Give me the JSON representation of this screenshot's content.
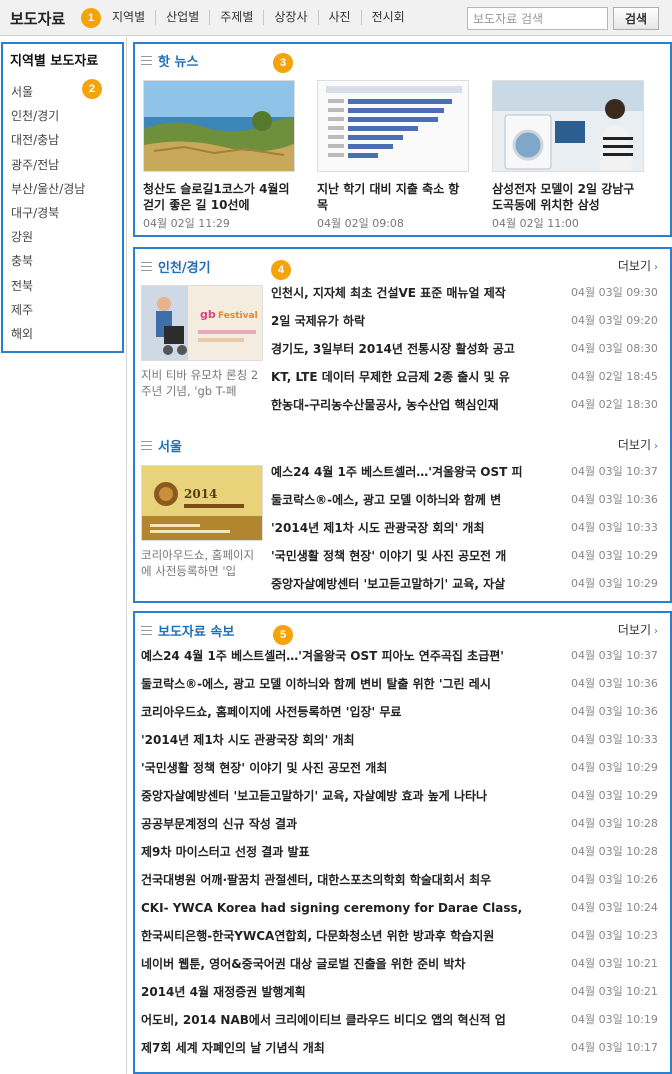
{
  "header": {
    "brand": "보도자료",
    "nav": [
      "지역별",
      "산업별",
      "주제별",
      "상장사",
      "사진",
      "전시회"
    ],
    "search_placeholder": "보도자료 검색",
    "search_button": "검색"
  },
  "markers": [
    "1",
    "2",
    "3",
    "4",
    "5"
  ],
  "sidebar": {
    "title": "지역별 보도자료",
    "items": [
      "서울",
      "인천/경기",
      "대전/충남",
      "광주/전남",
      "부산/울산/경남",
      "대구/경북",
      "강원",
      "충북",
      "전북",
      "제주",
      "해외"
    ]
  },
  "hot": {
    "title": "핫 뉴스",
    "cards": [
      {
        "title": "청산도 슬로길1코스가 4월의 걷기 좋은 길 10선에",
        "date": "04월 02일 11:29",
        "image": "coastal-landscape-photo"
      },
      {
        "title": "지난 학기 대비 지출 축소 항목",
        "date": "04월 02일 09:08",
        "image": "bar-chart-infographic"
      },
      {
        "title": "삼성전자 모델이 2일 강남구 도곡동에 위치한 삼성",
        "date": "04월 02일 11:00",
        "image": "model-with-washer-photo"
      }
    ]
  },
  "incheon": {
    "title": "인천/경기",
    "more": "더보기",
    "thumb_caption": "지비 티바 유모차 론칭 2주년 기념, 'gb T-페",
    "thumb_image": "stroller-festival-banner",
    "rows": [
      {
        "title": "인천시, 지자체 최초 건설VE 표준 매뉴얼 제작",
        "date": "04월 03일 09:30"
      },
      {
        "title": "2일 국제유가 하락",
        "date": "04월 03일 09:20"
      },
      {
        "title": "경기도, 3일부터 2014년 전통시장 활성화 공고",
        "date": "04월 03일 08:30"
      },
      {
        "title": "KT, LTE 데이터 무제한 요금제 2종 출시 및 유",
        "date": "04월 02일 18:45"
      },
      {
        "title": "한농대-구리농수산물공사, 농수산업 핵심인재",
        "date": "04월 02일 18:30"
      }
    ]
  },
  "seoul": {
    "title": "서울",
    "more": "더보기",
    "thumb_caption": "코리아우드쇼, 홈페이지에 사전등록하면 '입",
    "thumb_image": "korea-wood-show-poster",
    "rows": [
      {
        "title": "예스24 4월 1주 베스트셀러…'겨울왕국 OST 피",
        "date": "04월 03일 10:37"
      },
      {
        "title": "둘코락스®-에스, 광고 모델 이하늬와 함께 변",
        "date": "04월 03일 10:36"
      },
      {
        "title": "'2014년 제1차 시도 관광국장 회의' 개최",
        "date": "04월 03일 10:33"
      },
      {
        "title": "'국민생활 정책 현장' 이야기 및 사진 공모전 개",
        "date": "04월 03일 10:29"
      },
      {
        "title": "중앙자살예방센터 '보고듣고말하기' 교육, 자살",
        "date": "04월 03일 10:29"
      }
    ]
  },
  "breaking": {
    "title": "보도자료 속보",
    "more": "더보기",
    "rows": [
      {
        "title": "예스24 4월 1주 베스트셀러…'겨울왕국 OST 피아노 연주곡집 초급편'",
        "date": "04월 03일 10:37"
      },
      {
        "title": "둘코락스®-에스, 광고 모델 이하늬와 함께 변비 탈출 위한 '그린 레시",
        "date": "04월 03일 10:36"
      },
      {
        "title": "코리아우드쇼, 홈페이지에 사전등록하면 '입장' 무료",
        "date": "04월 03일 10:36"
      },
      {
        "title": "'2014년 제1차 시도 관광국장 회의' 개최",
        "date": "04월 03일 10:33"
      },
      {
        "title": "'국민생활 정책 현장' 이야기 및 사진 공모전 개최",
        "date": "04월 03일 10:29"
      },
      {
        "title": "중앙자살예방센터 '보고듣고말하기' 교육, 자살예방 효과 높게 나타나",
        "date": "04월 03일 10:29"
      },
      {
        "title": "공공부문계정의 신규 작성 결과",
        "date": "04월 03일 10:28"
      },
      {
        "title": "제9차 마이스터고 선정 결과 발표",
        "date": "04월 03일 10:28"
      },
      {
        "title": "건국대병원 어깨·팔꿈치 관절센터, 대한스포츠의학회 학술대회서 최우",
        "date": "04월 03일 10:26"
      },
      {
        "title": "CKI- YWCA Korea had signing ceremony for Darae Class,",
        "date": "04월 03일 10:24"
      },
      {
        "title": "한국씨티은행-한국YWCA연합회, 다문화청소년 위한 방과후 학습지원",
        "date": "04월 03일 10:23"
      },
      {
        "title": "네이버 웹툰, 영어&중국어권 대상 글로벌 진출을 위한 준비 박차",
        "date": "04월 03일 10:21"
      },
      {
        "title": "2014년 4월 재정증권 발행계획",
        "date": "04월 03일 10:21"
      },
      {
        "title": "어도비, 2014 NAB에서 크리에이티브 클라우드 비디오 앱의 혁신적 업",
        "date": "04월 03일 10:19"
      },
      {
        "title": "제7회 세계 자폐인의 날 기념식 개최",
        "date": "04월 03일 10:17"
      }
    ]
  },
  "colors": {
    "accent": "#2a7fcf",
    "marker": "#f5a30a",
    "title_blue": "#1f6fb8"
  }
}
